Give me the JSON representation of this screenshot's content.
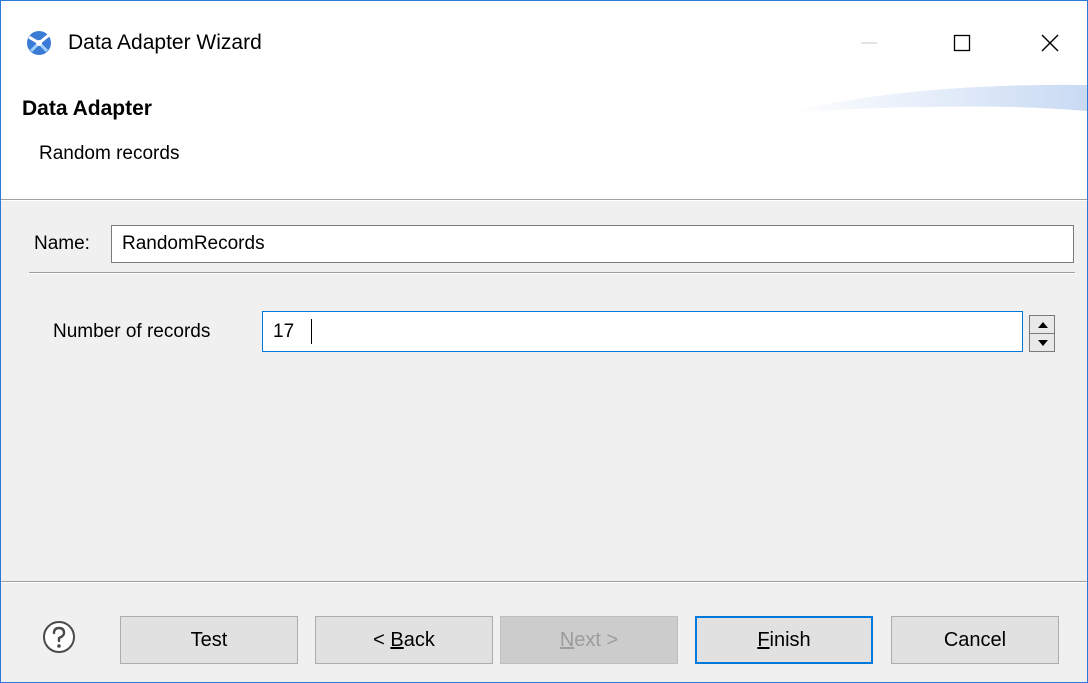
{
  "window": {
    "title": "Data Adapter Wizard",
    "icon": "data-adapter-icon"
  },
  "controls": {
    "minimize_icon": "minimize-icon",
    "maximize_icon": "maximize-icon",
    "close_icon": "close-icon"
  },
  "banner": {
    "title": "Data Adapter",
    "description": "Random records"
  },
  "form": {
    "name_label": "Name:",
    "name_value": "RandomRecords",
    "records_label": "Number of records",
    "records_value": "17"
  },
  "buttons": {
    "help_icon": "help-icon",
    "test": {
      "label": "Test"
    },
    "back": {
      "prefix": "< ",
      "mnemonic": "B",
      "rest": "ack"
    },
    "next": {
      "mnemonic": "N",
      "rest": "ext >",
      "enabled": false
    },
    "finish": {
      "mnemonic": "F",
      "rest": "inish",
      "default": true
    },
    "cancel": {
      "label": "Cancel"
    }
  },
  "colors": {
    "accent": "#0078d7",
    "window_border": "#2b79d8",
    "dialog_background": "#f0f0f0",
    "button_face": "#e1e1e1"
  }
}
